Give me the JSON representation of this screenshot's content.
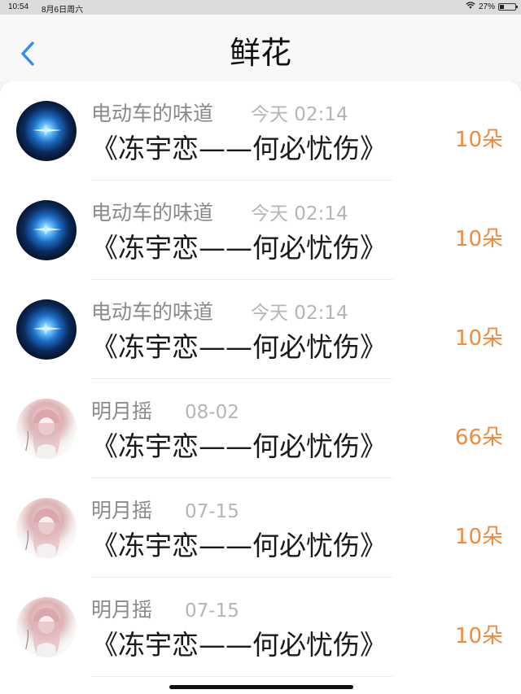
{
  "status_bar": {
    "time": "10:54",
    "date": "8月6日周六",
    "battery": "27%",
    "battery_level": 0.27
  },
  "navbar": {
    "title": "鲜花",
    "back_icon": "chevron-left-icon",
    "accent_color": "#2f8ee8"
  },
  "accent_amount_color": "#f08a3c",
  "records": [
    {
      "avatar": "blue-light-avatar",
      "name": "电动车的味道",
      "time": "今天 02:14",
      "song": "《冻宇恋——何必忧伤》",
      "amount": "10朵"
    },
    {
      "avatar": "blue-light-avatar",
      "name": "电动车的味道",
      "time": "今天 02:14",
      "song": "《冻宇恋——何必忧伤》",
      "amount": "10朵"
    },
    {
      "avatar": "blue-light-avatar",
      "name": "电动车的味道",
      "time": "今天 02:14",
      "song": "《冻宇恋——何必忧伤》",
      "amount": "10朵"
    },
    {
      "avatar": "anime-girl-avatar",
      "name": "明月摇",
      "time": "08-02",
      "song": "《冻宇恋——何必忧伤》",
      "amount": "66朵"
    },
    {
      "avatar": "anime-girl-avatar",
      "name": "明月摇",
      "time": "07-15",
      "song": "《冻宇恋——何必忧伤》",
      "amount": "10朵"
    },
    {
      "avatar": "anime-girl-avatar",
      "name": "明月摇",
      "time": "07-15",
      "song": "《冻宇恋——何必忧伤》",
      "amount": "10朵"
    }
  ]
}
